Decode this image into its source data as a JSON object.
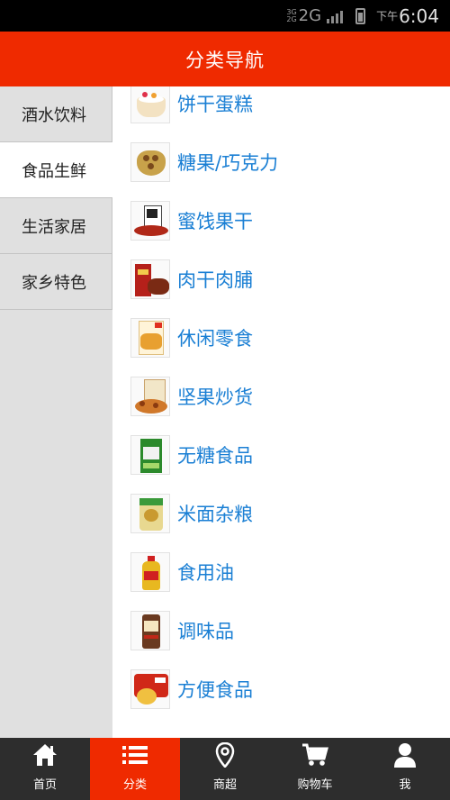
{
  "status_bar": {
    "network_small_top": "3G",
    "network_small_bottom": "2G",
    "network": "2G",
    "time_prefix": "下午",
    "time": "6:04"
  },
  "header": {
    "title": "分类导航"
  },
  "sidebar": {
    "items": [
      {
        "label": "酒水饮料"
      },
      {
        "label": "食品生鲜"
      },
      {
        "label": "生活家居"
      },
      {
        "label": "家乡特色"
      }
    ],
    "active_index": 1
  },
  "categories": [
    {
      "label": "饼干蛋糕",
      "icon": "cake-icon"
    },
    {
      "label": "糖果/巧克力",
      "icon": "chocolate-icon"
    },
    {
      "label": "蜜饯果干",
      "icon": "dried-fruit-icon"
    },
    {
      "label": "肉干肉脯",
      "icon": "jerky-icon"
    },
    {
      "label": "休闲零食",
      "icon": "snack-icon"
    },
    {
      "label": "坚果炒货",
      "icon": "nuts-icon"
    },
    {
      "label": "无糖食品",
      "icon": "sugar-free-icon"
    },
    {
      "label": "米面杂粮",
      "icon": "rice-bag-icon"
    },
    {
      "label": "食用油",
      "icon": "oil-bottle-icon"
    },
    {
      "label": "调味品",
      "icon": "seasoning-icon"
    },
    {
      "label": "方便食品",
      "icon": "instant-noodle-icon"
    }
  ],
  "bottom_nav": {
    "items": [
      {
        "label": "首页",
        "icon": "home-icon"
      },
      {
        "label": "分类",
        "icon": "list-icon"
      },
      {
        "label": "商超",
        "icon": "location-pin-icon"
      },
      {
        "label": "购物车",
        "icon": "cart-icon"
      },
      {
        "label": "我",
        "icon": "user-icon"
      }
    ],
    "active_index": 1
  },
  "colors": {
    "accent": "#ef2a00",
    "link": "#1a7fd4",
    "sidebar_bg": "#e0e0e0",
    "nav_bg": "#2d2d2d"
  }
}
